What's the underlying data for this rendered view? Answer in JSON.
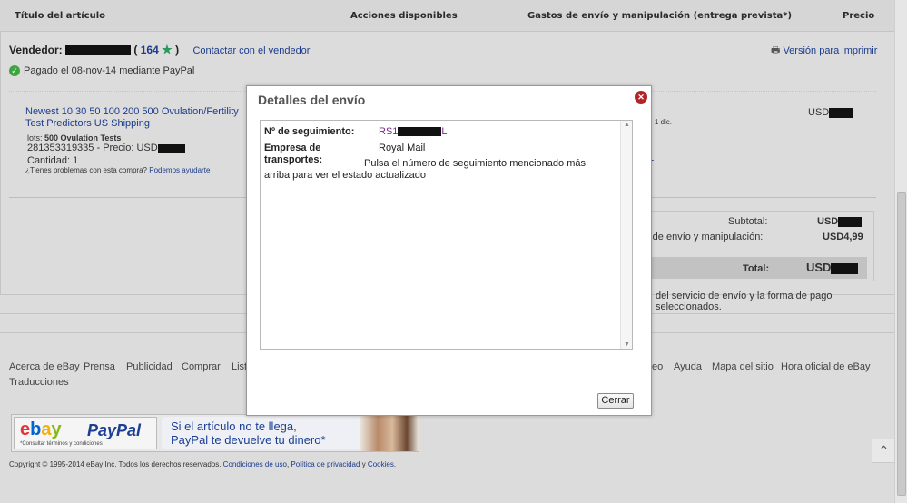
{
  "table_header": {
    "col_title": "Título del artículo",
    "col_actions": "Acciones disponibles",
    "col_shipping": "Gastos de envío y manipulación (entrega prevista*)",
    "col_price": "Precio"
  },
  "order": {
    "seller_label": "Vendedor:",
    "feedback_score": "164",
    "contact_seller": "Contactar con el vendedor",
    "print_version": "Versión para imprimir",
    "paid_status": "Pagado el 08-nov-14 mediante PayPal",
    "item": {
      "title": "Newest 10 30 50 100 200 500 Ovulation/Fertility Test Predictors US Shipping",
      "lots_label": "lots:",
      "lots_value": "500 Ovulation Tests",
      "id_price": "281353319335 - Precio: USD",
      "quantity": "Cantidad: 1",
      "help_text": "¿Tienes problemas con esta compra?",
      "help_link": "Podemos ayudarte"
    },
    "price": "USD",
    "ship_date": "n. 1 dic.",
    "ship_link": "L",
    "totals": {
      "subtotal_label": "Subtotal:",
      "subtotal_value": "USD",
      "shipping_label": "os de envío y manipulación:",
      "shipping_value": "USD4,99",
      "total_label": "Total:",
      "total_value": "USD"
    },
    "note": "del servicio de envío y la forma de pago seleccionados."
  },
  "footer": {
    "links_left": [
      "Acerca de eBay",
      "Prensa",
      "Publicidad",
      "Comprar",
      "List"
    ],
    "links_right": [
      "eo",
      "Ayuda",
      "Mapa del sitio",
      "Hora oficial de eBay"
    ],
    "translations": "Traducciones",
    "banner": {
      "ebay": "ebay",
      "paypal": "PayPal",
      "terms": "*Consultar términos y condiciones",
      "line1": "Si el artículo no te llega,",
      "line2": "PayPal te devuelve tu dinero*"
    },
    "copyright": "Copyright © 1995-2014 eBay Inc. Todos los derechos reservados.",
    "terms_link": "Condiciones de uso",
    "privacy_link": "Política de privacidad",
    "and_text": "y",
    "cookies_link": "Cookies"
  },
  "modal": {
    "title": "Detalles del envío",
    "tracking_label": "Nº de seguimiento:",
    "tracking_prefix": "RS1",
    "tracking_suffix": "L",
    "carrier_label": "Empresa de transportes:",
    "carrier_value": "Royal Mail",
    "message": "Pulsa el número de seguimiento mencionado más arriba para ver el estado actualizado",
    "close_button": "Cerrar"
  },
  "colors": {
    "link": "#1a3c8c",
    "tracking": "#7a2a8c",
    "close_icon": "#b4232a",
    "paid_check": "#3ea43e"
  }
}
